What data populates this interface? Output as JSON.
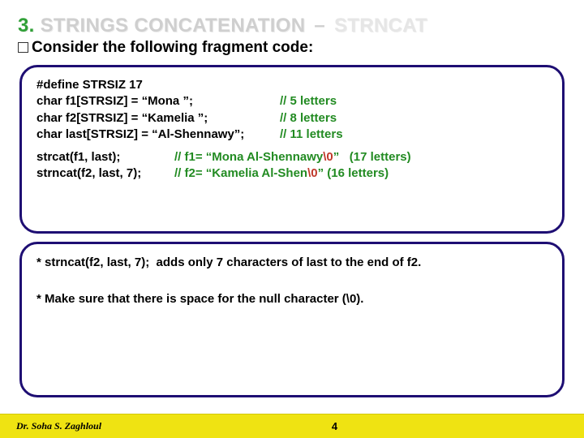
{
  "title": {
    "num": "3.",
    "main": "STRINGS CONCATENATION",
    "dash": "–",
    "sub": "STRNCAT"
  },
  "lead": "Consider the following fragment code:",
  "code": {
    "lines": [
      {
        "left": "#define STRSIZ 17",
        "cmt": ""
      },
      {
        "left": "char f1[STRSIZ] = “Mona ”;",
        "cmt": "// 5 letters"
      },
      {
        "left": "char f2[STRSIZ] = “Kamelia ”;",
        "cmt": "// 8 letters"
      },
      {
        "left": "char last[STRSIZ] = “Al-Shennawy”;",
        "cmt": "// 11 letters"
      }
    ],
    "calls": [
      {
        "left": "strcat(f1, last);",
        "cmt_pre": "// f1= “Mona Al-Shennawy",
        "zero": "\\0",
        "cmt_post": "”   (17 letters)"
      },
      {
        "left": "strncat(f2, last, 7);",
        "cmt_pre": "// f2= “Kamelia Al-Shen",
        "zero": "\\0",
        "cmt_post": "” (16 letters)"
      }
    ]
  },
  "notes": {
    "line1": "* strncat(f2, last, 7);  adds only 7 characters of last to the end of f2.",
    "line2": "* Make sure that there is space for the null character (\\0)."
  },
  "footer": {
    "author": "Dr. Soha S. Zaghloul",
    "page": "4"
  }
}
